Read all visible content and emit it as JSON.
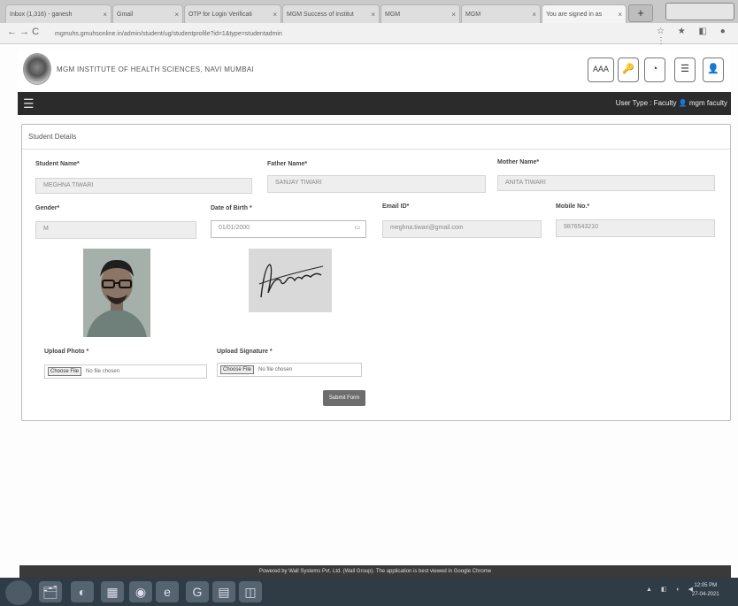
{
  "browser": {
    "tabs": [
      {
        "label": "Inbox (1,316) - ganesh",
        "active": false
      },
      {
        "label": "Gmail",
        "active": false
      },
      {
        "label": "OTP for Login Verificati",
        "active": false
      },
      {
        "label": "MGM Success of Institut",
        "active": false
      },
      {
        "label": "MGM",
        "active": false
      },
      {
        "label": "MGM",
        "active": false
      },
      {
        "label": "You are signed in as",
        "active": true
      }
    ],
    "new_tab": "+",
    "nav": "← → C",
    "url": "mgmuhs.gmuhsonline.in/admin/student/ug/studentprofile?id=1&type=studentadmin",
    "icons": "☆ ★ ◧ ● ⋮"
  },
  "header": {
    "institute": "MGM INSTITUTE OF HEALTH SCIENCES, NAVI MUMBAI",
    "buttons": [
      "AAA",
      "🔑",
      "◔",
      "☰",
      "👤"
    ],
    "user_type": "User Type : Faculty  👤 mgm faculty"
  },
  "form": {
    "title": "Student Details",
    "student_name": {
      "label": "Student Name*",
      "value": "MEGHNA TIWARI"
    },
    "father_name": {
      "label": "Father Name*",
      "value": "SANJAY TIWARI"
    },
    "mother_name": {
      "label": "Mother Name*",
      "value": "ANITA TIWARI"
    },
    "gender": {
      "label": "Gender*",
      "value": "M"
    },
    "dob": {
      "label": "Date of Birth *",
      "value": "01/01/2000"
    },
    "email": {
      "label": "Email ID*",
      "value": "meghna.tiwari@gmail.com"
    },
    "mobile": {
      "label": "Mobile No.*",
      "value": "9876543210"
    },
    "upload_photo": {
      "label": "Upload Photo *",
      "choose": "Choose File",
      "status": "No file chosen"
    },
    "upload_signature": {
      "label": "Upload Signature *",
      "choose": "Choose File",
      "status": "No file chosen"
    },
    "submit": "Submit Form",
    "calendar_icon": "▭"
  },
  "footer": {
    "text": "Powered by Wall Systems Pvt. Ltd. (Wall Group). The application is best viewed in Google Chrome"
  },
  "taskbar": {
    "icons": [
      "🗂",
      "◐",
      "▦",
      "◉",
      "e",
      "G",
      "▤",
      "◫"
    ],
    "tray": "▲ ◧ ◖ ◀",
    "time": "12:05 PM",
    "date": "27-04-2021"
  }
}
